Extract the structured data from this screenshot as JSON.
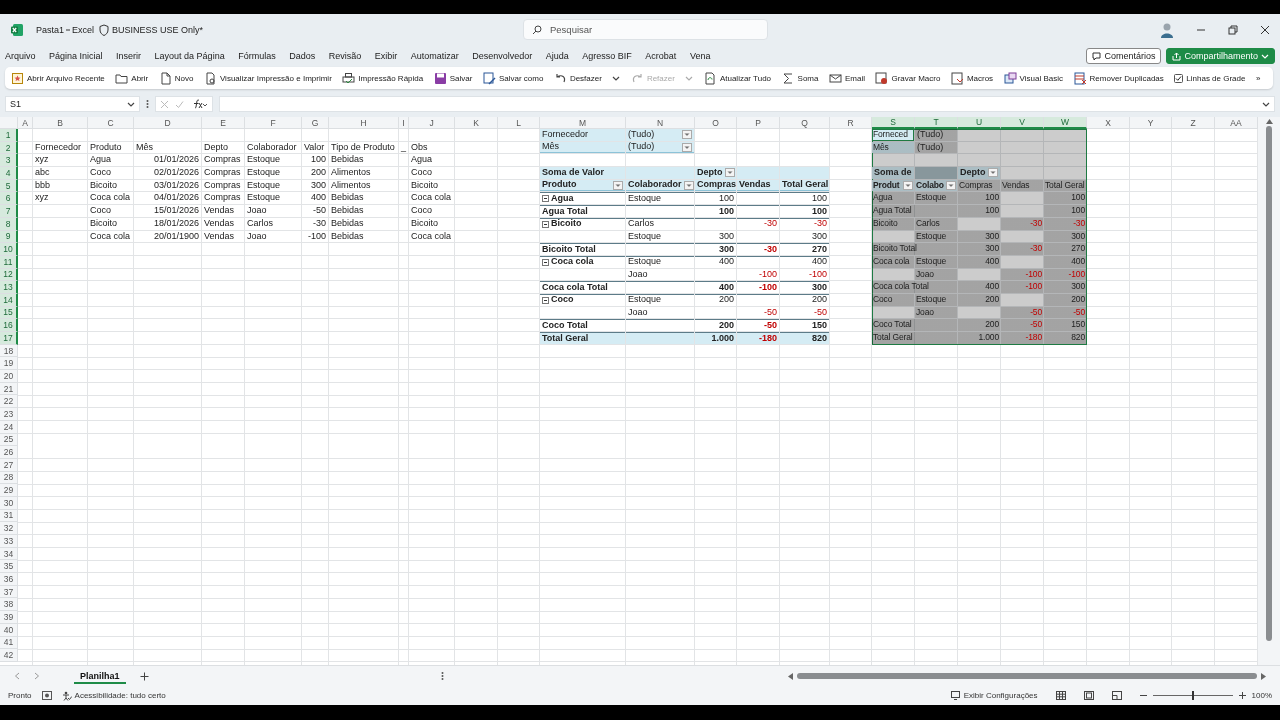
{
  "window": {
    "file": "Pasta1",
    "app": "Excel",
    "label": "BUSINESS USE Only*"
  },
  "search": {
    "placeholder": "Pesquisar"
  },
  "menu": [
    "Arquivo",
    "Página Inicial",
    "Inserir",
    "Layout da Página",
    "Fórmulas",
    "Dados",
    "Revisão",
    "Exibir",
    "Automatizar",
    "Desenvolvedor",
    "Ajuda",
    "Agresso BIF",
    "Acrobat",
    "Vena"
  ],
  "comments_button": "Comentários",
  "share_button": "Compartilhamento",
  "toolbar": [
    {
      "label": "Abrir Arquivo Recente",
      "kind": "button",
      "disabled": false
    },
    {
      "label": "Abrir",
      "kind": "button",
      "disabled": false
    },
    {
      "label": "Novo",
      "kind": "button",
      "disabled": false
    },
    {
      "label": "Visualizar Impressão e Imprimir",
      "kind": "button",
      "disabled": false
    },
    {
      "label": "Impressão Rápida",
      "kind": "button",
      "disabled": false
    },
    {
      "label": "Salvar",
      "kind": "button",
      "disabled": false
    },
    {
      "label": "Salvar como",
      "kind": "button",
      "disabled": false
    },
    {
      "label": "Desfazer",
      "kind": "split",
      "disabled": false
    },
    {
      "label": "Refazer",
      "kind": "split",
      "disabled": true
    },
    {
      "label": "Atualizar Tudo",
      "kind": "button",
      "disabled": false
    },
    {
      "label": "Soma",
      "kind": "button",
      "disabled": false
    },
    {
      "label": "Email",
      "kind": "button",
      "disabled": false
    },
    {
      "label": "Gravar Macro",
      "kind": "button",
      "disabled": false
    },
    {
      "label": "Macros",
      "kind": "button",
      "disabled": false
    },
    {
      "label": "Visual Basic",
      "kind": "button",
      "disabled": false
    },
    {
      "label": "Remover Duplicadas",
      "kind": "button",
      "disabled": false
    },
    {
      "label": "Linhas de Grade",
      "kind": "checkbox",
      "checked": true,
      "disabled": false
    },
    {
      "label": "»",
      "kind": "overflow",
      "disabled": false
    }
  ],
  "formula_bar": {
    "name_box": "S1"
  },
  "sheet": {
    "columns": [
      "A",
      "B",
      "C",
      "D",
      "E",
      "F",
      "G",
      "H",
      "I",
      "J",
      "K",
      "L",
      "M",
      "N",
      "O",
      "P",
      "Q",
      "R",
      "S",
      "T",
      "U",
      "V",
      "W",
      "X",
      "Y",
      "Z",
      "AA"
    ],
    "row_numbers": [
      "1",
      "2",
      "3",
      "4",
      "5",
      "6",
      "7",
      "8",
      "9",
      "10",
      "11",
      "12",
      "13",
      "14",
      "15",
      "16",
      "17",
      "18",
      "19",
      "20",
      "21",
      "22",
      "23",
      "24",
      "25",
      "26",
      "27",
      "28",
      "29",
      "30",
      "31",
      "32",
      "33",
      "34",
      "35",
      "36",
      "37",
      "38",
      "39",
      "40",
      "41",
      "42"
    ],
    "tables": [
      {
        "kind": "list",
        "selected": false,
        "columns": [
          "Fornecedor",
          "Produto",
          "Mês",
          "Depto",
          "Colaborador",
          "Valor",
          "Tipo de Produto",
          "_",
          "Obs"
        ],
        "rows": [
          [
            "xyz",
            "Agua",
            "01/01/2026",
            "Compras",
            "Estoque",
            "100",
            "Bebidas",
            null,
            "Agua"
          ],
          [
            "abc",
            "Coco",
            "02/01/2026",
            "Compras",
            "Estoque",
            "200",
            "Alimentos",
            null,
            "Coco"
          ],
          [
            "bbb",
            "Bicoito",
            "03/01/2026",
            "Compras",
            "Estoque",
            "300",
            "Alimentos",
            null,
            "Bicoito"
          ],
          [
            "xyz",
            "Coca cola",
            "04/01/2026",
            "Compras",
            "Estoque",
            "400",
            "Bebidas",
            null,
            "Coca cola"
          ],
          [
            null,
            "Coco",
            "15/01/2026",
            "Vendas",
            "Joao",
            "-50",
            "Bebidas",
            null,
            "Coco"
          ],
          [
            null,
            "Bicoito",
            "18/01/2026",
            "Vendas",
            "Carlos",
            "-30",
            "Bebidas",
            null,
            "Bicoito"
          ],
          [
            null,
            "Coca cola",
            "20/01/1900",
            "Vendas",
            "Joao",
            "-100",
            "Bebidas",
            null,
            "Coca cola"
          ]
        ],
        "number_columns": [
          false,
          false,
          true,
          false,
          false,
          true,
          false,
          false,
          false
        ]
      },
      {
        "kind": "pivot_outline",
        "selected": false,
        "filters": [
          {
            "label": "Fornecedor",
            "value": "(Tudo)",
            "dropdown": true
          },
          {
            "label": "Mês",
            "value": "(Tudo)",
            "dropdown": true
          }
        ],
        "value_label": "Soma de Valor",
        "column_field": {
          "label": "Depto",
          "dropdown": true
        },
        "header": [
          {
            "text": "Produto",
            "dropdown": true
          },
          {
            "text": "Colaborador",
            "dropdown": true
          },
          {
            "text": "Compras",
            "dropdown": false
          },
          {
            "text": "Vendas",
            "dropdown": false
          },
          {
            "text": "Total Geral",
            "dropdown": false
          }
        ],
        "rows": [
          {
            "kind": "item",
            "collapse": true,
            "cells": [
              "Agua",
              "Estoque",
              "100",
              null,
              "100"
            ]
          },
          {
            "kind": "subtotal",
            "cells": [
              "Agua Total",
              null,
              "100",
              null,
              "100"
            ]
          },
          {
            "kind": "item",
            "collapse": true,
            "cells": [
              "Bicoito",
              "Carlos",
              null,
              {
                "text": "-30",
                "negative": true
              },
              {
                "text": "-30",
                "negative": true
              }
            ]
          },
          {
            "kind": "detail",
            "cells": [
              null,
              "Estoque",
              "300",
              null,
              "300"
            ]
          },
          {
            "kind": "subtotal",
            "cells": [
              "Bicoito Total",
              null,
              "300",
              {
                "text": "-30",
                "negative": true
              },
              "270"
            ]
          },
          {
            "kind": "item",
            "collapse": true,
            "cells": [
              "Coca cola",
              "Estoque",
              "400",
              null,
              "400"
            ]
          },
          {
            "kind": "detail",
            "cells": [
              null,
              "Joao",
              null,
              {
                "text": "-100",
                "negative": true
              },
              {
                "text": "-100",
                "negative": true
              }
            ]
          },
          {
            "kind": "subtotal",
            "cells": [
              "Coca cola Total",
              null,
              "400",
              {
                "text": "-100",
                "negative": true
              },
              "300"
            ]
          },
          {
            "kind": "item",
            "collapse": true,
            "cells": [
              "Coco",
              "Estoque",
              "200",
              null,
              "200"
            ]
          },
          {
            "kind": "detail",
            "cells": [
              null,
              "Joao",
              null,
              {
                "text": "-50",
                "negative": true
              },
              {
                "text": "-50",
                "negative": true
              }
            ]
          },
          {
            "kind": "subtotal",
            "cells": [
              "Coco Total",
              null,
              "200",
              {
                "text": "-50",
                "negative": true
              },
              "150"
            ]
          },
          {
            "kind": "grand",
            "cells": [
              "Total Geral",
              null,
              "1.000",
              {
                "text": "-180",
                "negative": true
              },
              "820"
            ]
          }
        ]
      },
      {
        "kind": "pivot_tabular",
        "selected": true,
        "filters": [
          {
            "label": "Forneced",
            "value": "(Tudo)",
            "dropdown": false
          },
          {
            "label": "Mês",
            "value": "(Tudo)",
            "dropdown": false
          }
        ],
        "value_label": "Soma de",
        "column_field": {
          "label": "Depto",
          "dropdown": true
        },
        "header": [
          {
            "text": "Produt",
            "dropdown": true
          },
          {
            "text": "Colabo",
            "dropdown": true
          },
          {
            "text": "Compras",
            "dropdown": false
          },
          {
            "text": "Vendas",
            "dropdown": false
          },
          {
            "text": "Total Geral",
            "dropdown": false
          }
        ],
        "rows": [
          {
            "kind": "item",
            "collapse": false,
            "cells": [
              "Agua",
              "Estoque",
              "100",
              null,
              "100"
            ]
          },
          {
            "kind": "subtotal",
            "cells": [
              "Agua Total",
              null,
              "100",
              null,
              "100"
            ]
          },
          {
            "kind": "item",
            "collapse": false,
            "cells": [
              "Bicoito",
              "Carlos",
              null,
              {
                "text": "-30",
                "negative": true
              },
              {
                "text": "-30",
                "negative": true
              }
            ]
          },
          {
            "kind": "detail",
            "cells": [
              null,
              "Estoque",
              "300",
              null,
              "300"
            ]
          },
          {
            "kind": "subtotal",
            "cells": [
              "Bicoito Total",
              null,
              "300",
              {
                "text": "-30",
                "negative": true
              },
              "270"
            ]
          },
          {
            "kind": "item",
            "collapse": false,
            "cells": [
              "Coca cola",
              "Estoque",
              "400",
              null,
              "400"
            ]
          },
          {
            "kind": "detail",
            "cells": [
              null,
              "Joao",
              null,
              {
                "text": "-100",
                "negative": true
              },
              {
                "text": "-100",
                "negative": true
              }
            ]
          },
          {
            "kind": "subtotal",
            "cells": [
              "Coca cola Total",
              null,
              "400",
              {
                "text": "-100",
                "negative": true
              },
              "300"
            ]
          },
          {
            "kind": "item",
            "collapse": false,
            "cells": [
              "Coco",
              "Estoque",
              "200",
              null,
              "200"
            ]
          },
          {
            "kind": "detail",
            "cells": [
              null,
              "Joao",
              null,
              {
                "text": "-50",
                "negative": true
              },
              {
                "text": "-50",
                "negative": true
              }
            ]
          },
          {
            "kind": "subtotal",
            "cells": [
              "Coco Total",
              null,
              "200",
              {
                "text": "-50",
                "negative": true
              },
              "150"
            ]
          },
          {
            "kind": "grand",
            "cells": [
              "Total Geral",
              null,
              "1.000",
              {
                "text": "-180",
                "negative": true
              },
              "820"
            ]
          }
        ]
      }
    ]
  },
  "sheet_tabs": [
    {
      "label": "Planilha1",
      "selected": true
    }
  ],
  "status_bar": {
    "mode": "Pronto",
    "accessibility": "Acessibilidade: tudo certo",
    "display_settings": "Exibir Configurações",
    "zoom": "100%",
    "zoom_level": {
      "level": 0.5
    }
  }
}
